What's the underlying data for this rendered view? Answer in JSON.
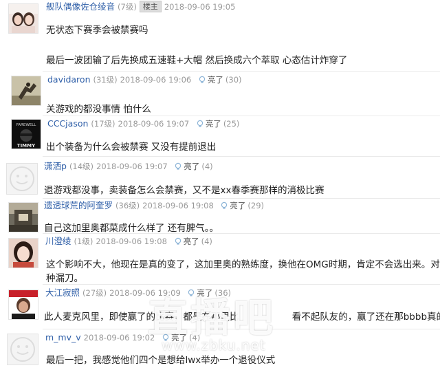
{
  "like_label": "亮了",
  "posts": [
    {
      "user": "舰队偶像佐仓绫音",
      "level": "(7级)",
      "badge": "楼主",
      "date": "2018-09-06 19:05",
      "content": [
        "无状态下赛季会被禁赛吗",
        "",
        "最后一波团输了后先换成五速鞋+大帽 然后换成六个萃取 心态估计炸穿了"
      ]
    },
    {
      "user": "davidaron",
      "level": "(31级)",
      "date": "2018-09-06 19:06",
      "likes": "(30)",
      "content": [
        "关游戏的都没事情 怕什么"
      ]
    },
    {
      "user": "CCCjason",
      "level": "(17级)",
      "date": "2018-09-06 19:07",
      "likes": "(25)",
      "avatar_text": [
        "FAREWELL",
        "TIMMY"
      ],
      "content": [
        "出个装备为什么会被禁赛 又没有提前退出"
      ]
    },
    {
      "user": "潇洒p",
      "level": "(14级)",
      "date": "2018-09-06 19:07",
      "likes": "(4)",
      "content": [
        "退游戏都没事，卖装备怎么会禁赛，又不是xx春季赛那样的消极比赛"
      ]
    },
    {
      "user": "遗透球荒的阿奎罗",
      "level": "(36级)",
      "date": "2018-09-06 19:08",
      "likes": "(29)",
      "content": [
        "自己这加里奥都菜成什么样了 还有脾气。。"
      ]
    },
    {
      "user": "川澄绫",
      "level": "(1级)",
      "date": "2018-09-06 19:08",
      "likes": "(4)",
      "content": [
        "这个影响不大，他现在是真的变了，这加里奥的熟练度，换他在OMG时期，肯定不会选出来。对线",
        "种漏刀。"
      ]
    },
    {
      "user": "大江寂照",
      "level": "(27级)",
      "date": "2018-09-06 19:09",
      "likes": "(36)",
      "content": [
        "此人麦克风里，即使赢了的比赛，都是在那里比                  看不起队友的，赢了还在那bbbb真的挺作"
      ]
    },
    {
      "user": "m_mv_v",
      "date": "2018-09-06 19:02",
      "likes": "(4)",
      "content": [
        "最后一把，我感觉他们四个是想给lwx举办一个退役仪式"
      ]
    }
  ],
  "watermark": {
    "brand": "直播吧",
    "url": "www.zbku.net"
  }
}
